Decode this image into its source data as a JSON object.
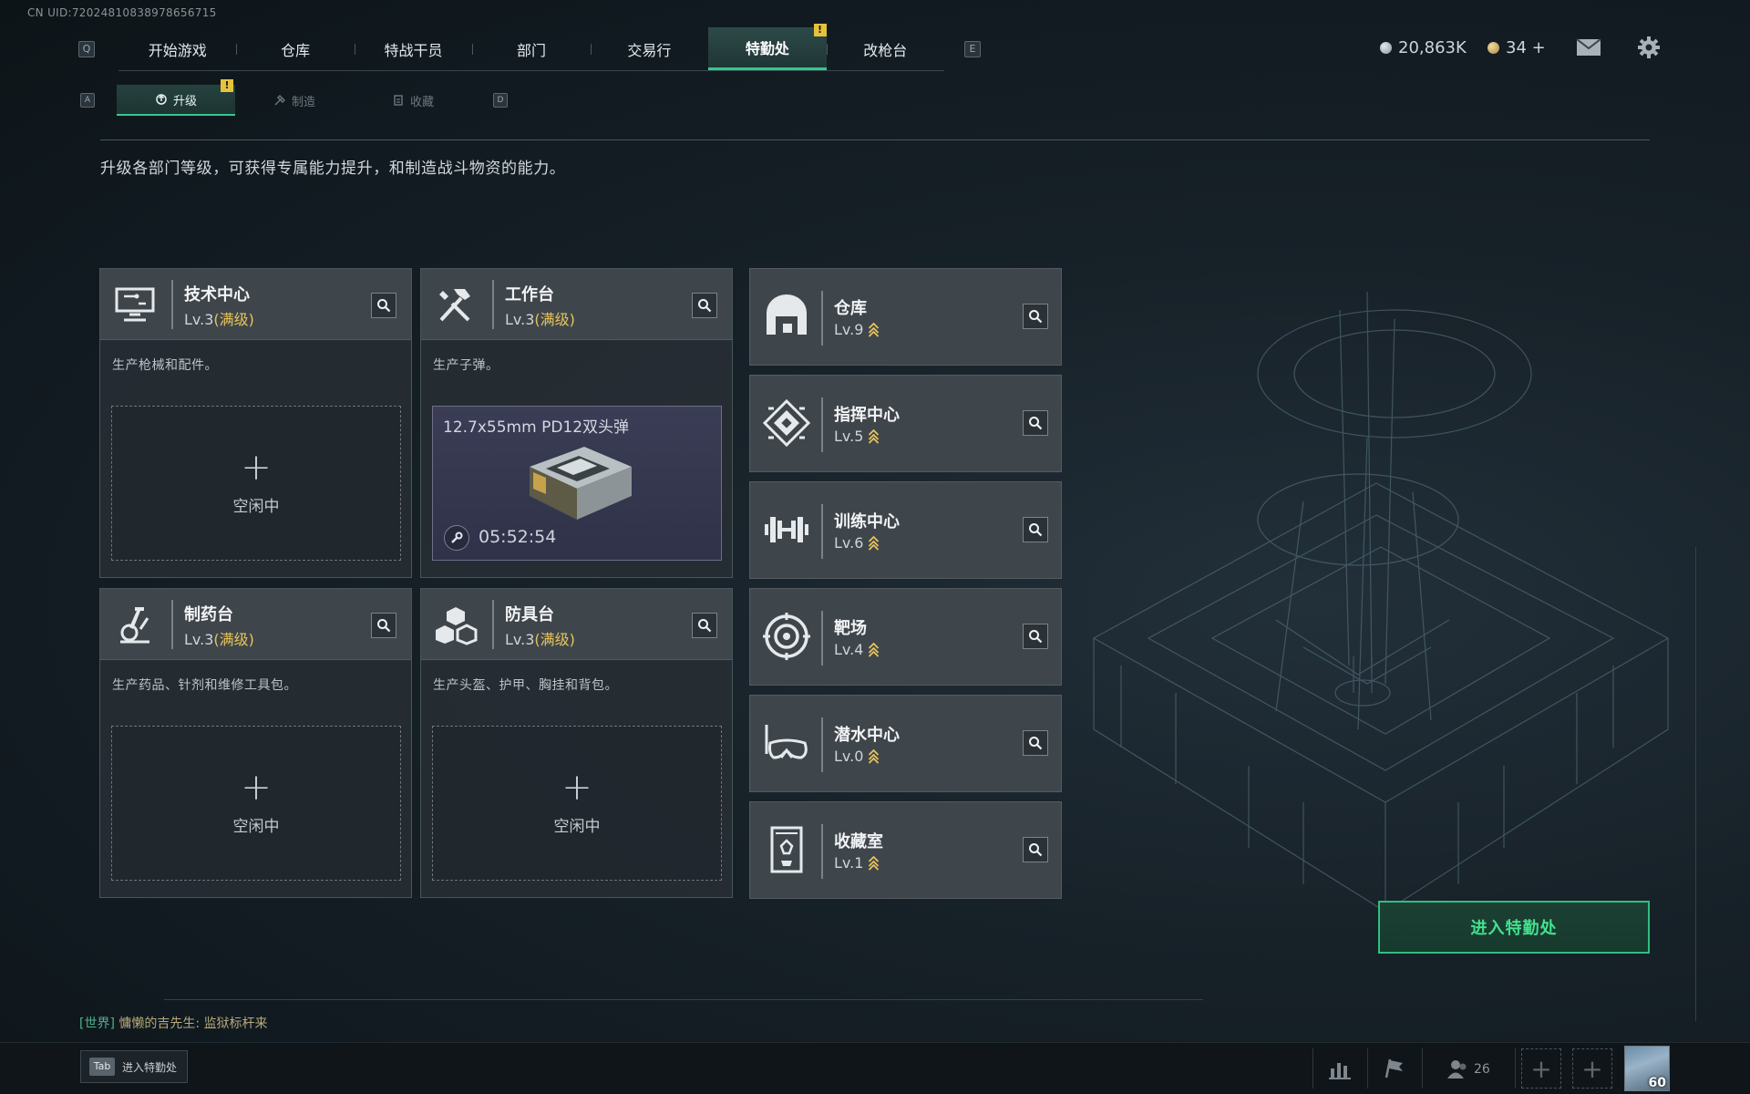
{
  "uid_text": "CN UID:72024810838978656715",
  "keyhints": {
    "q": "Q",
    "e": "E",
    "a": "A",
    "d": "D"
  },
  "nav": {
    "tabs": [
      {
        "label": "开始游戏"
      },
      {
        "label": "仓库"
      },
      {
        "label": "特战干员"
      },
      {
        "label": "部门"
      },
      {
        "label": "交易行"
      },
      {
        "label": "特勤处",
        "active": true,
        "alert": "!"
      },
      {
        "label": "改枪台"
      }
    ]
  },
  "subnav": {
    "tabs": [
      {
        "label": "升级",
        "active": true,
        "alert": "!",
        "icon": "upgrade-icon"
      },
      {
        "label": "制造",
        "icon": "craft-icon"
      },
      {
        "label": "收藏",
        "icon": "collection-icon"
      }
    ]
  },
  "currency": {
    "silver": "20,863K",
    "gold": "34 +",
    "silver_color": "#aeb6bc",
    "gold_color": "#d6b567"
  },
  "description": "升级各部门等级，可获得专属能力提升，和制造战斗物资的能力。",
  "production_cards": [
    {
      "name": "技术中心",
      "level_prefix": "Lv.3",
      "level_tag": "(满级)",
      "desc": "生产枪械和配件。",
      "icon": "tech-center-icon",
      "slot": {
        "plus": "+",
        "status": "空闲中"
      }
    },
    {
      "name": "工作台",
      "level_prefix": "Lv.3",
      "level_tag": "(满级)",
      "desc": "生产子弹。",
      "icon": "workbench-icon",
      "production": {
        "item": "12.7x55mm PD12双头弹",
        "timer": "05:52:54"
      }
    },
    {
      "name": "制药台",
      "level_prefix": "Lv.3",
      "level_tag": "(满级)",
      "desc": "生产药品、针剂和维修工具包。",
      "icon": "pharmacy-icon",
      "slot": {
        "plus": "+",
        "status": "空闲中"
      }
    },
    {
      "name": "防具台",
      "level_prefix": "Lv.3",
      "level_tag": "(满级)",
      "desc": "生产头盔、护甲、胸挂和背包。",
      "icon": "armor-bench-icon",
      "slot": {
        "plus": "+",
        "status": "空闲中"
      }
    }
  ],
  "buildings": [
    {
      "name": "仓库",
      "level": "Lv.9",
      "icon": "warehouse-icon"
    },
    {
      "name": "指挥中心",
      "level": "Lv.5",
      "icon": "command-center-icon"
    },
    {
      "name": "训练中心",
      "level": "Lv.6",
      "icon": "training-center-icon"
    },
    {
      "name": "靶场",
      "level": "Lv.4",
      "icon": "shooting-range-icon"
    },
    {
      "name": "潜水中心",
      "level": "Lv.0",
      "icon": "diving-center-icon"
    },
    {
      "name": "收藏室",
      "level": "Lv.1",
      "icon": "collection-room-icon"
    }
  ],
  "enter_button": "进入特勤处",
  "chat": {
    "channel": "[世界]",
    "sender": "慵懒的吉先生:",
    "message": "监狱标杆来"
  },
  "bottom": {
    "tab_key": "Tab",
    "tab_label": "进入特勤处",
    "friends_count": "26",
    "player_level": "60"
  },
  "colors": {
    "accent_green": "#35c88e",
    "max_level_gold": "#e8c35a",
    "alert_yellow": "#e5c23b"
  }
}
